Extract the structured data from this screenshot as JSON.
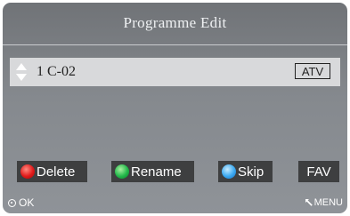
{
  "title": "Programme Edit",
  "channel_row": {
    "number_name": "1 C-02",
    "type_badge": "ATV"
  },
  "buttons": {
    "delete": "Delete",
    "rename": "Rename",
    "skip": "Skip",
    "fav": "FAV"
  },
  "footer": {
    "ok": "OK",
    "menu": "MENU"
  },
  "colors": {
    "delete_dot": "#e01a1a",
    "rename_dot": "#22b84a",
    "skip_dot": "#3aa8f0",
    "selected_row": "#d8d9db",
    "button_bg": "#3e3f40"
  }
}
